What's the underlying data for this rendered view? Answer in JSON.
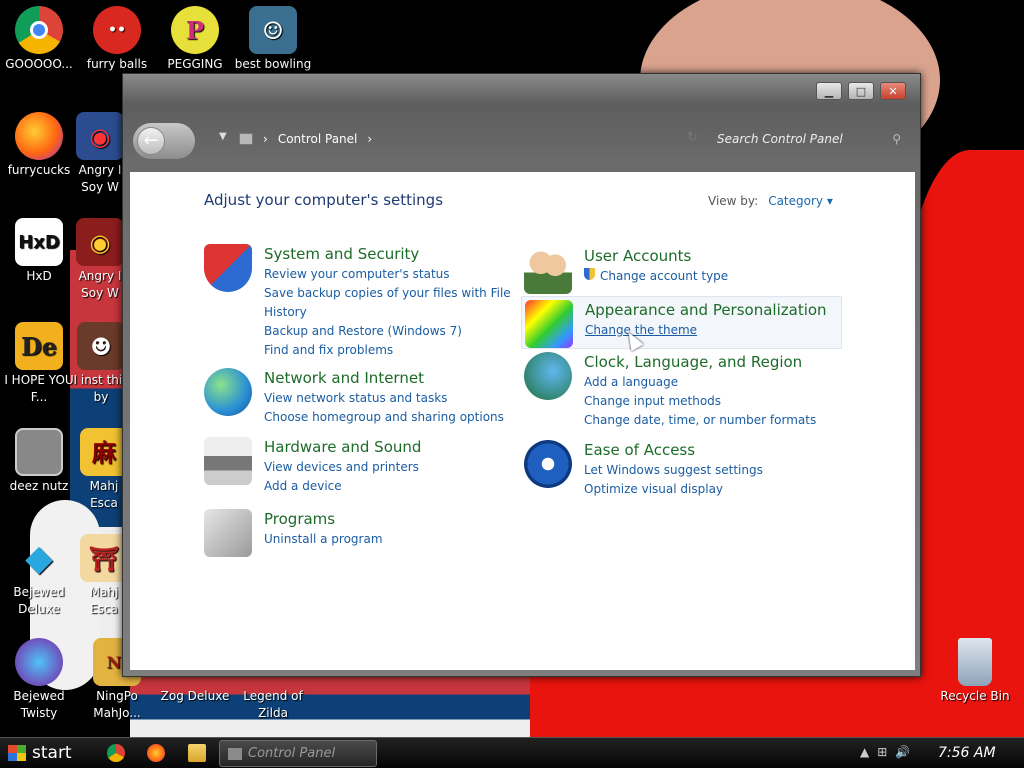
{
  "desktop": {
    "icons": [
      {
        "label": "GOOOOO...",
        "icon": "chrome-icon"
      },
      {
        "label": "furry balls",
        "icon": "furry-ball-icon"
      },
      {
        "label": "PEGGING",
        "icon": "pegging-icon"
      },
      {
        "label": "best bowling",
        "icon": "bowling-icon"
      },
      {
        "label": "furrycucks",
        "icon": "firefox-icon"
      },
      {
        "label": "Angry I Soy W",
        "icon": "angry-birds-icon"
      },
      {
        "label": "HxD",
        "icon": "hxd-icon"
      },
      {
        "label": "Angry I Soy W",
        "icon": "angry-birds-icon"
      },
      {
        "label": "I HOPE YOU F...",
        "icon": "de-icon"
      },
      {
        "label": "I inst this by",
        "icon": "app-icon"
      },
      {
        "label": "deez nutz",
        "icon": "folder-stack-icon"
      },
      {
        "label": "Mahj Esca",
        "icon": "mahjong-icon"
      },
      {
        "label": "Bejewed Deluxe",
        "icon": "bejeweled-icon"
      },
      {
        "label": "Mahj Esca",
        "icon": "mahjong-icon"
      },
      {
        "label": "Bejewed Twisty",
        "icon": "bejeweled-twist-icon"
      },
      {
        "label": "NingPo MahJo...",
        "icon": "ningpo-icon"
      },
      {
        "label": "Zog Deluxe",
        "icon": "zog-icon"
      },
      {
        "label": "Legend of Zilda",
        "icon": "zelda-icon"
      },
      {
        "label": "Recycle Bin",
        "icon": "recycle-bin-icon"
      }
    ],
    "accent_red": "#e8140d"
  },
  "window": {
    "breadcrumb": "Control Panel",
    "search_placeholder": "Search Control Panel",
    "heading": "Adjust your computer's settings",
    "view_by_label": "View by:",
    "view_by_value": "Category",
    "left_categories": [
      {
        "title": "System and Security",
        "links": [
          "Review your computer's status",
          "Save backup copies of your files with File",
          "History",
          "Backup and Restore (Windows 7)",
          "Find and fix problems"
        ]
      },
      {
        "title": "Network and Internet",
        "links": [
          "View network status and tasks",
          "Choose homegroup and sharing options"
        ]
      },
      {
        "title": "Hardware and Sound",
        "links": [
          "View devices and printers",
          "Add a device"
        ]
      },
      {
        "title": "Programs",
        "links": [
          "Uninstall a program"
        ]
      }
    ],
    "right_categories": [
      {
        "title": "User Accounts",
        "links": [
          "Change account type"
        ]
      },
      {
        "title": "Appearance and Personalization",
        "links": [
          "Change the theme"
        ]
      },
      {
        "title": "Clock, Language, and Region",
        "links": [
          "Add a language",
          "Change input methods",
          "Change date, time, or number formats"
        ]
      },
      {
        "title": "Ease of Access",
        "links": [
          "Let Windows suggest settings",
          "Optimize visual display"
        ]
      }
    ]
  },
  "taskbar": {
    "start_label": "start",
    "task_label": "Control Panel",
    "clock": "7:56 AM"
  }
}
